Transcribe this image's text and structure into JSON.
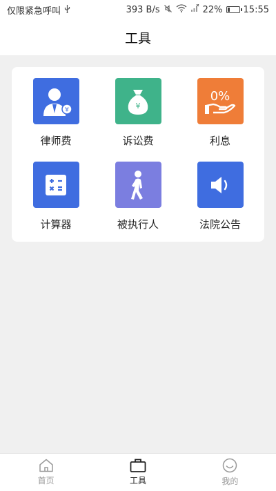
{
  "status_bar": {
    "carrier_text": "仅限紧急呼叫",
    "usb_icon": "usb-icon",
    "network_speed": "393 B/s",
    "mute_icon": "mute-icon",
    "wifi_icon": "wifi-icon",
    "signal_icon": "no-signal-icon",
    "battery_percent": "22%",
    "battery_level": 0.22,
    "time": "15:55"
  },
  "header": {
    "title": "工具"
  },
  "tools": [
    {
      "label": "律师费",
      "icon": "lawyer-fee-icon",
      "color": "#3f6de0"
    },
    {
      "label": "诉讼费",
      "icon": "money-bag-icon",
      "color": "#3fb38a"
    },
    {
      "label": "利息",
      "icon": "interest-icon",
      "color": "#ef7d38"
    },
    {
      "label": "计算器",
      "icon": "calculator-icon",
      "color": "#3f6de0"
    },
    {
      "label": "被执行人",
      "icon": "walking-person-icon",
      "color": "#7b7ee0"
    },
    {
      "label": "法院公告",
      "icon": "speaker-icon",
      "color": "#3f6de0"
    }
  ],
  "tabbar": {
    "active_tab": "工具",
    "tabs": [
      {
        "label": "首页",
        "icon": "home-icon"
      },
      {
        "label": "工具",
        "icon": "toolbox-icon"
      },
      {
        "label": "我的",
        "icon": "smiley-icon"
      }
    ]
  }
}
